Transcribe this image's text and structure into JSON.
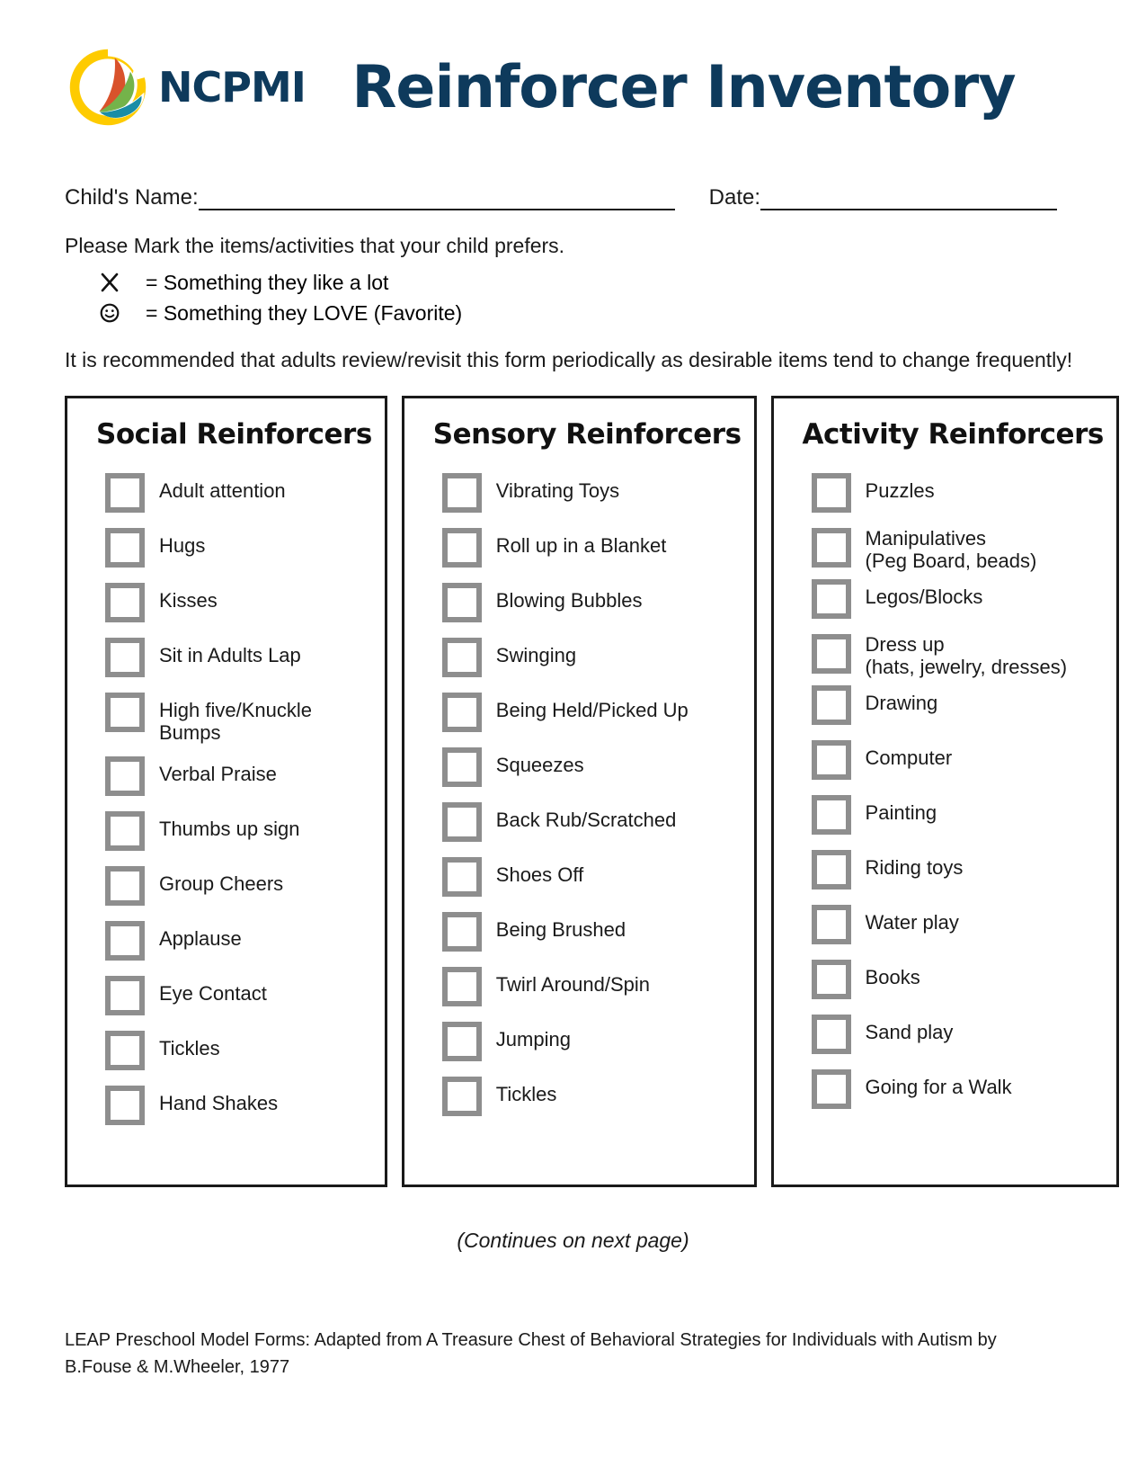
{
  "header": {
    "logo_word": "NCPMI",
    "logo_icon": "ncpmi-swoosh-logo",
    "title": "Reinforcer Inventory",
    "brand_color": "#0e3a5c"
  },
  "form": {
    "child_name_label": "Child's Name:",
    "date_label": "Date:"
  },
  "instructions": {
    "main": "Please Mark the items/activities that your child prefers.",
    "legend": [
      {
        "glyph": "x-mark-icon",
        "text": "= Something they like a lot"
      },
      {
        "glyph": "smiley-face-icon",
        "text": "= Something they LOVE (Favorite)"
      }
    ],
    "recommendation": "It is recommended that adults review/revisit this form periodically as desirable items tend to change frequently!"
  },
  "columns": [
    {
      "title": "Social Reinforcers",
      "items": [
        "Adult attention",
        "Hugs",
        "Kisses",
        "Sit in Adults Lap",
        "High five/Knuckle Bumps",
        "Verbal Praise",
        "Thumbs up sign",
        "Group Cheers",
        "Applause",
        "Eye Contact",
        "Tickles",
        "Hand Shakes"
      ]
    },
    {
      "title": "Sensory Reinforcers",
      "items": [
        "Vibrating Toys",
        "Roll up in a Blanket",
        "Blowing Bubbles",
        "Swinging",
        "Being Held/Picked Up",
        "Squeezes",
        "Back Rub/Scratched",
        "Shoes Off",
        "Being Brushed",
        "Twirl Around/Spin",
        "Jumping",
        "Tickles"
      ]
    },
    {
      "title": "Activity Reinforcers",
      "items": [
        "Puzzles",
        "Manipulatives\n(Peg Board, beads)",
        "Legos/Blocks",
        "Dress up\n(hats, jewelry, dresses)",
        "Drawing",
        "Computer",
        "Painting",
        "Riding toys",
        "Water play",
        "Books",
        "Sand play",
        "Going for a Walk"
      ]
    }
  ],
  "footer": {
    "continues": "(Continues on next page)",
    "citation_line_1": "LEAP Preschool Model Forms:  Adapted from A Treasure Chest of Behavioral Strategies for Individuals with Autism by",
    "citation_line_2": "B.Fouse & M.Wheeler, 1977"
  }
}
